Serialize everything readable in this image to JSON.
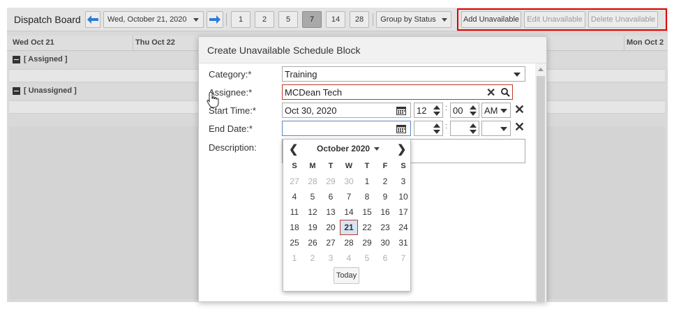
{
  "toolbar": {
    "title": "Dispatch Board",
    "date": "Wed, October 21, 2020",
    "day_ranges": [
      "1",
      "2",
      "5",
      "7",
      "14",
      "28"
    ],
    "active_range": "7",
    "group_by": "Group by Status",
    "add_unavailable": "Add Unavailable",
    "edit_unavailable": "Edit Unavailable",
    "delete_unavailable": "Delete Unavailable"
  },
  "columns": [
    "Wed Oct 21",
    "Thu Oct 22",
    "Mon Oct 2"
  ],
  "groups": [
    "[ Assigned ]",
    "[ Unassigned ]"
  ],
  "dialog": {
    "title": "Create Unavailable Schedule Block",
    "category_label": "Category:*",
    "category_value": "Training",
    "assignee_label": "Assignee:*",
    "assignee_value": "MCDean Tech",
    "start_label": "Start Time:*",
    "start_date": "Oct 30, 2020",
    "start_hour": "12",
    "start_minute": "00",
    "start_ampm": "AM",
    "end_label": "End Date:*",
    "end_date": "",
    "description_label": "Description:"
  },
  "calendar": {
    "month": "October 2020",
    "weekdays": [
      "S",
      "M",
      "T",
      "W",
      "T",
      "F",
      "S"
    ],
    "weeks": [
      [
        "27",
        "28",
        "29",
        "30",
        "1",
        "2",
        "3"
      ],
      [
        "4",
        "5",
        "6",
        "7",
        "8",
        "9",
        "10"
      ],
      [
        "11",
        "12",
        "13",
        "14",
        "15",
        "16",
        "17"
      ],
      [
        "18",
        "19",
        "20",
        "21",
        "22",
        "23",
        "24"
      ],
      [
        "25",
        "26",
        "27",
        "28",
        "29",
        "30",
        "31"
      ],
      [
        "1",
        "2",
        "3",
        "4",
        "5",
        "6",
        "7"
      ]
    ],
    "selected": "21",
    "today_label": "Today"
  },
  "colors": {
    "highlight_frame": "#e60000",
    "selected_day_bg": "#d5e5f5"
  }
}
